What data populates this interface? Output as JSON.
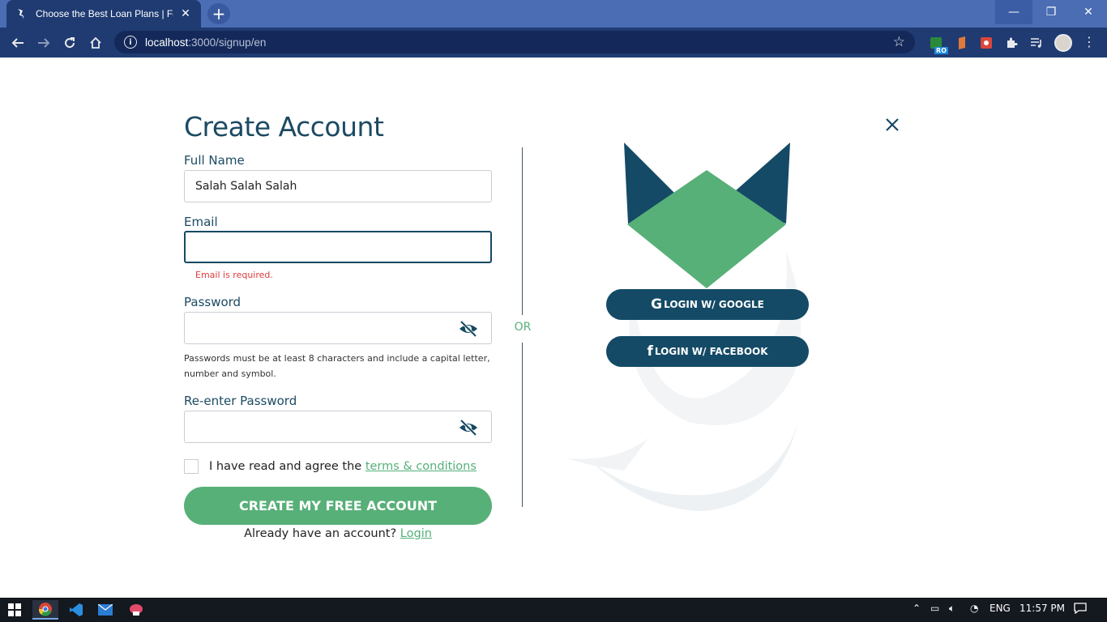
{
  "browser": {
    "tab_title": "Choose the Best Loan Plans | Fay",
    "tab_close": "✕",
    "new_tab": "+",
    "url_host": "localhost",
    "url_path": ":3000/signup/en",
    "ext_badge": "RO",
    "window_min": "—",
    "window_max": "❐",
    "window_close": "✕"
  },
  "form": {
    "title": "Create Account",
    "full_name_label": "Full Name",
    "full_name_value": "Salah Salah Salah",
    "email_label": "Email",
    "email_value": "",
    "email_error": "Email is required.",
    "password_label": "Password",
    "password_hint": "Passwords must be at least 8 characters and include a capital letter, number and symbol.",
    "reenter_label": "Re-enter Password",
    "agree_prefix": "I have read and agree the ",
    "terms_link": "terms & conditions",
    "submit_label": "CREATE MY FREE ACCOUNT",
    "have_account": "Already have an account? ",
    "login_link": "Login"
  },
  "divider_text": "OR",
  "social": {
    "google_icon": "G",
    "google_label": "LOGIN W/ GOOGLE",
    "facebook_icon": "f",
    "facebook_label": "LOGIN W/ FACEBOOK"
  },
  "taskbar": {
    "language": "ENG",
    "time": "11:57 PM"
  },
  "colors": {
    "brand_dark": "#144a66",
    "brand_green": "#57b078",
    "error": "#dd3b3b"
  }
}
